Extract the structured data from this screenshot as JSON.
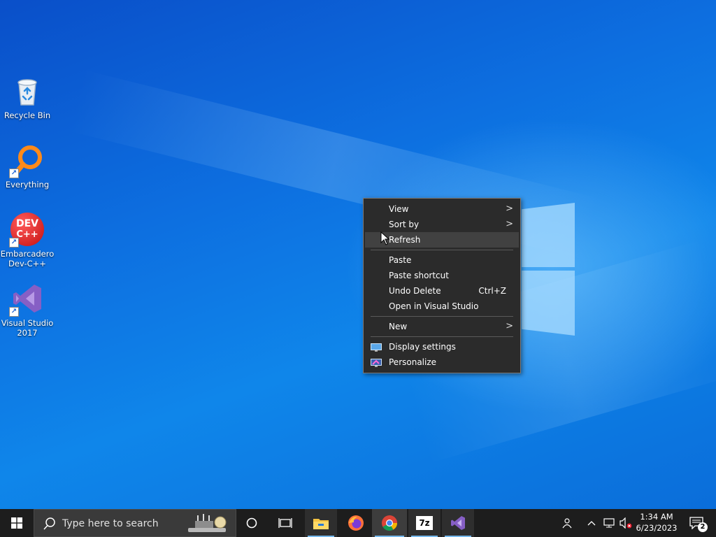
{
  "desktop": {
    "icons": [
      {
        "label_line1": "Recycle Bin",
        "label_line2": "",
        "icon": "recycle-bin-icon"
      },
      {
        "label_line1": "Everything",
        "label_line2": "",
        "icon": "everything-search-icon"
      },
      {
        "label_line1": "Embarcadero",
        "label_line2": "Dev-C++",
        "icon": "devcpp-icon",
        "badge_line1": "DEV",
        "badge_line2": "C++"
      },
      {
        "label_line1": "Visual Studio",
        "label_line2": "2017",
        "icon": "visual-studio-icon"
      }
    ]
  },
  "context_menu": {
    "items": {
      "view": "View",
      "sort_by": "Sort by",
      "refresh": "Refresh",
      "paste": "Paste",
      "paste_shortcut": "Paste shortcut",
      "undo_delete": "Undo Delete",
      "undo_delete_shortcut": "Ctrl+Z",
      "open_in_vs": "Open in Visual Studio",
      "new": "New",
      "display_settings": "Display settings",
      "personalize": "Personalize"
    },
    "submenu_glyph": ">",
    "hovered_item": "Refresh"
  },
  "taskbar": {
    "search_placeholder": "Type here to search",
    "apps": [
      "file-explorer",
      "firefox",
      "chrome",
      "7zip",
      "visual-studio"
    ],
    "active_app": "chrome",
    "sevenzip_label": "7z",
    "clock": {
      "time": "1:34 AM",
      "date": "6/23/2023"
    },
    "notification_count": "2"
  },
  "colors": {
    "menu_bg": "#2b2b2b",
    "menu_hover": "#414141",
    "taskbar_bg": "#1d1d1d",
    "accent": "#76b9ed"
  }
}
